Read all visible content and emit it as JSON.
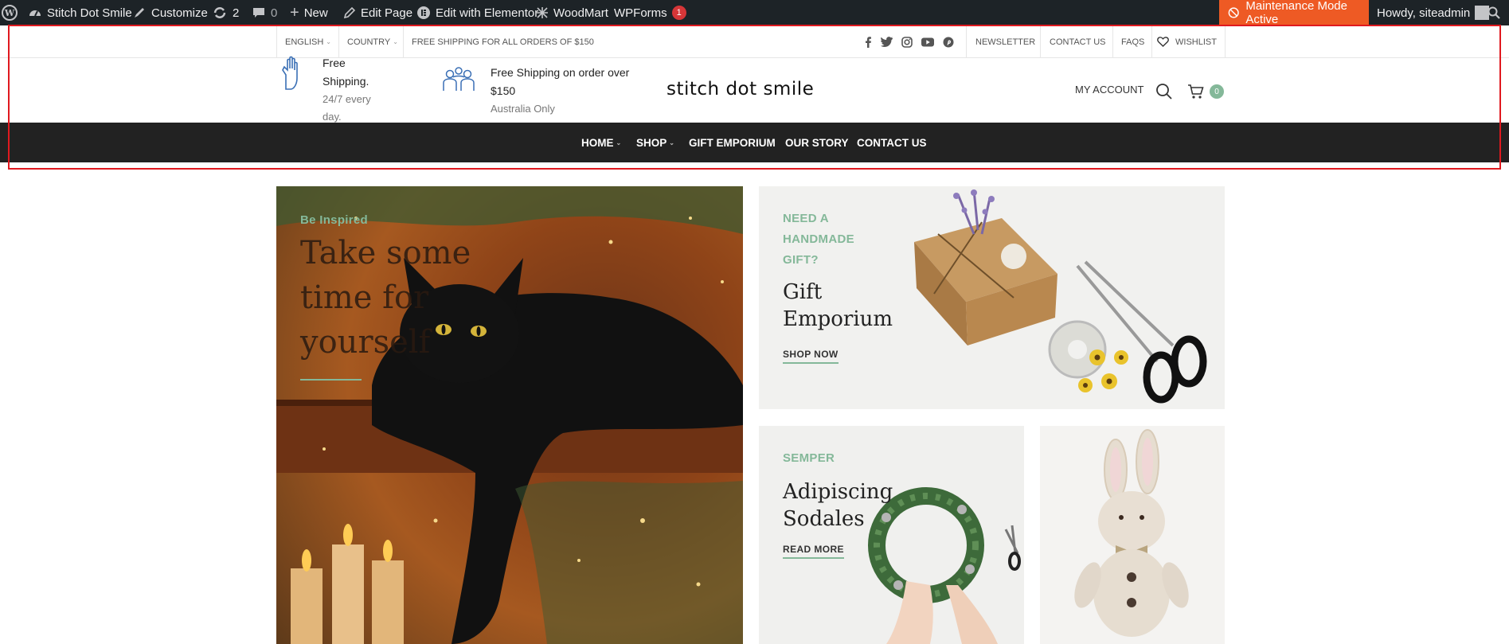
{
  "admin_bar": {
    "site_name": "Stitch Dot Smile",
    "customize": "Customize",
    "updates_count": "2",
    "comments_count": "0",
    "new_label": "New",
    "edit_page": "Edit Page",
    "edit_elementor": "Edit with Elementor",
    "woodmart": "WoodMart",
    "wpforms": "WPForms",
    "wpforms_badge": "1",
    "maintenance": "Maintenance Mode Active",
    "howdy": "Howdy, siteadmin"
  },
  "top_bar": {
    "language": "ENGLISH",
    "country": "COUNTRY",
    "shipping_notice": "FREE SHIPPING FOR ALL ORDERS OF $150",
    "social_icons": [
      "facebook-icon",
      "twitter-icon",
      "instagram-icon",
      "youtube-icon",
      "pinterest-icon"
    ],
    "links": [
      "NEWSLETTER",
      "CONTACT US",
      "FAQS"
    ],
    "wishlist": "WISHLIST"
  },
  "header": {
    "info1_title_line1": "Free",
    "info1_title_line2": "Shipping.",
    "info1_sub_line1": "24/7 every",
    "info1_sub_line2": "day.",
    "info2_title_line1": "Free Shipping on order over",
    "info2_title_line2": "$150",
    "info2_sub": "Australia Only",
    "logo": "stitch dot smile",
    "my_account": "MY ACCOUNT",
    "cart_count": "0"
  },
  "nav": {
    "items": [
      "HOME",
      "SHOP",
      "GIFT EMPORIUM",
      "OUR STORY",
      "CONTACT US"
    ]
  },
  "banners": {
    "main": {
      "subtitle": "Be Inspired",
      "title_line1": "Take some",
      "title_line2": "time for",
      "title_line3": "yourself"
    },
    "gift": {
      "subtitle_line1": "NEED A",
      "subtitle_line2": "HANDMADE",
      "subtitle_line3": "GIFT?",
      "title_line1": "Gift",
      "title_line2": "Emporium",
      "button": "SHOP NOW"
    },
    "semper": {
      "subtitle": "SEMPER",
      "title_line1": "Adipiscing",
      "title_line2": "Sodales",
      "button": "READ MORE"
    }
  },
  "colors": {
    "accent": "#84b899",
    "nav_bg": "#222222",
    "admin_bar_bg": "#1d2327",
    "maintenance_bg": "#ee5a24",
    "highlight": "#e0191f"
  }
}
